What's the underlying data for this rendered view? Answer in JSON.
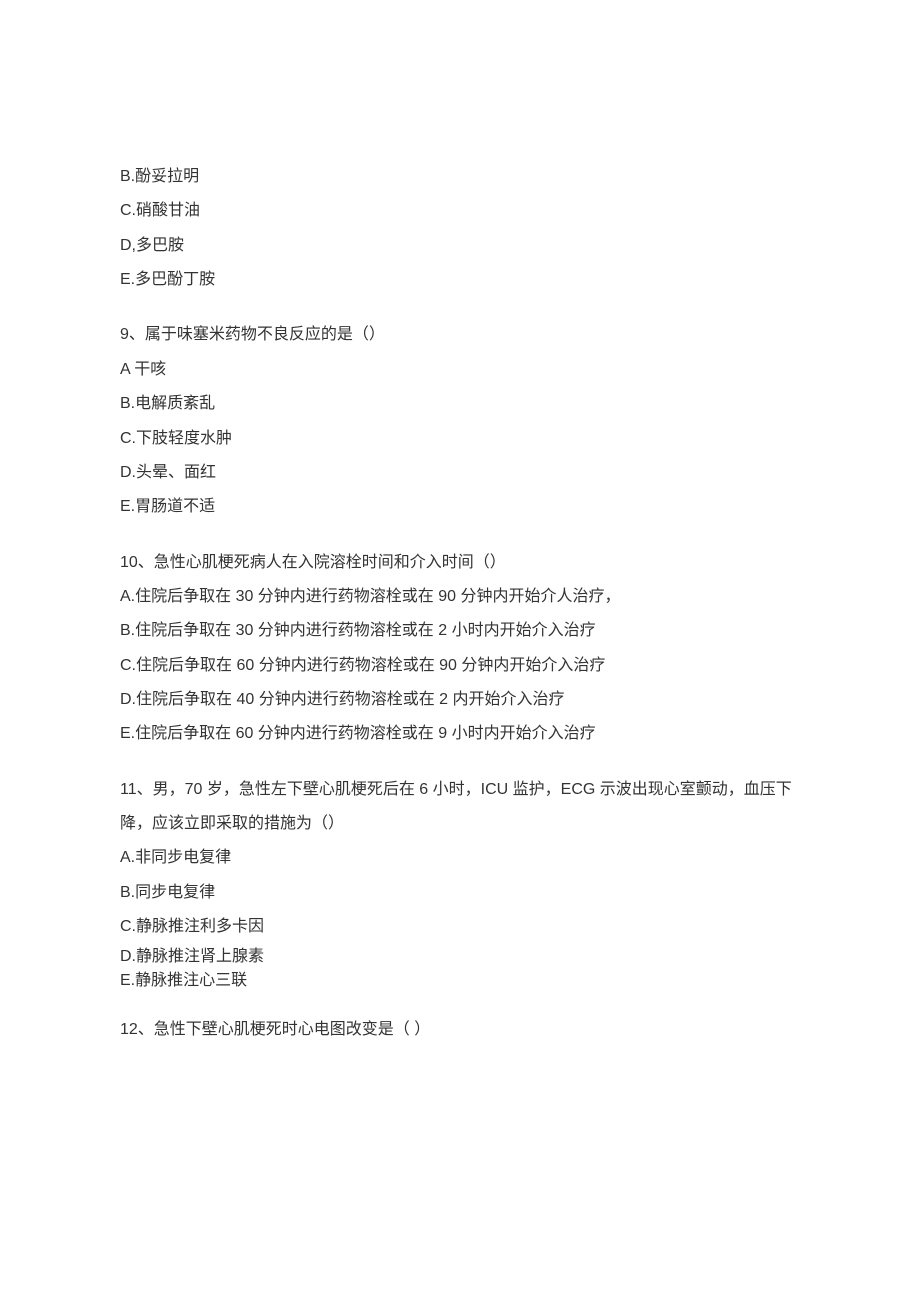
{
  "q8": {
    "optB": "B.酚妥拉明",
    "optC": "C.硝酸甘油",
    "optD": "D,多巴胺",
    "optE": "E.多巴酚丁胺"
  },
  "q9": {
    "stem": "9、属于味塞米药物不良反应的是（）",
    "optA": "A 干咳",
    "optB": "B.电解质紊乱",
    "optC": "C.下肢轻度水肿",
    "optD": "D.头晕、面红",
    "optE": "E.胃肠道不适"
  },
  "q10": {
    "stem": "10、急性心肌梗死病人在入院溶栓时间和介入时间（）",
    "optA": "A.住院后争取在 30 分钟内进行药物溶栓或在 90 分钟内开始介人治疗，",
    "optB": "B.住院后争取在 30 分钟内进行药物溶栓或在 2 小时内开始介入治疗",
    "optC": "C.住院后争取在 60 分钟内进行药物溶栓或在 90 分钟内开始介入治疗",
    "optD": "D.住院后争取在 40 分钟内进行药物溶栓或在 2 内开始介入治疗",
    "optE": "E.住院后争取在 60 分钟内进行药物溶栓或在 9 小时内开始介入治疗"
  },
  "q11": {
    "stem": "11、男，70 岁，急性左下壁心肌梗死后在 6 小时，ICU 监护，ECG 示波出现心室颤动，血压下降，应该立即采取的措施为（）",
    "optA": "A.非同步电复律",
    "optB": "B.同步电复律",
    "optC": "C.静脉推注利多卡因",
    "optD": "D.静脉推注肾上腺素",
    "optE": "E.静脉推注心三联"
  },
  "q12": {
    "stem": "12、急性下壁心肌梗死时心电图改变是（ ）"
  }
}
